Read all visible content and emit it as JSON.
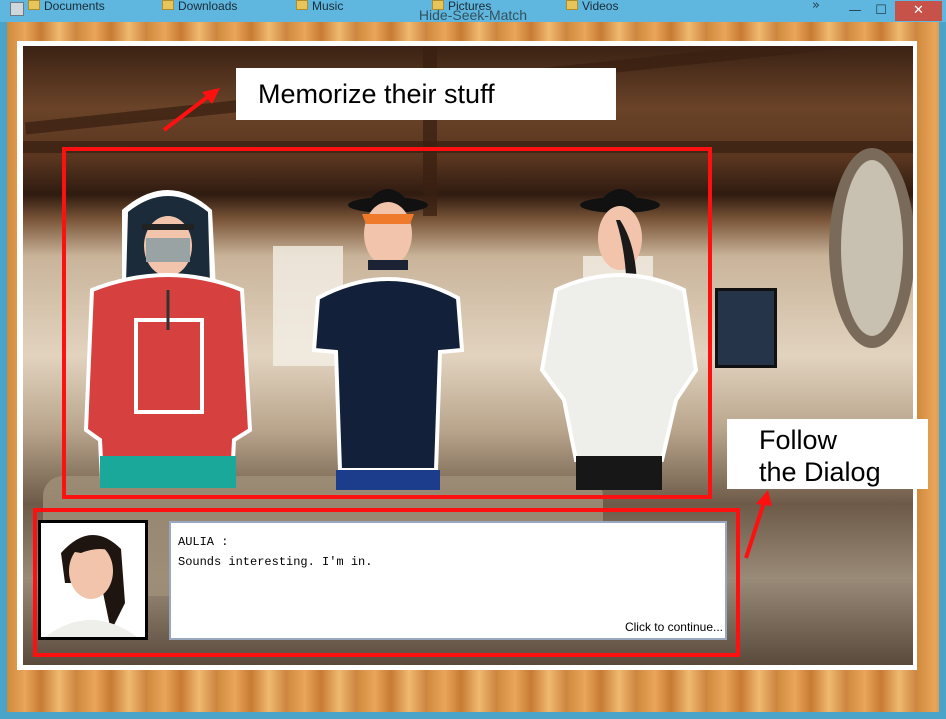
{
  "window": {
    "title": "Hide-Seek-Match",
    "bookmarks": [
      "Documents",
      "Downloads",
      "Music",
      "Pictures",
      "Videos"
    ],
    "overflow": "»",
    "minimize": "—",
    "maximize": "☐",
    "close": "✕"
  },
  "annotations": {
    "memorize": "Memorize their stuff",
    "follow_line1": "Follow",
    "follow_line2": "the Dialog"
  },
  "dialog": {
    "speaker": "AULIA :",
    "line": "Sounds interesting. I'm in.",
    "continue": "Click to continue..."
  },
  "colors": {
    "highlight": "#ff1010",
    "titlebar": "#5fb6de",
    "close": "#c7524a"
  }
}
